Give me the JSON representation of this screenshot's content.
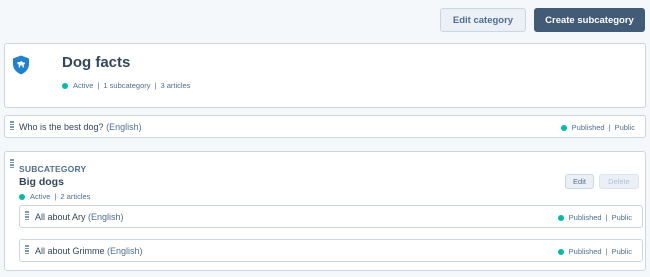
{
  "header": {
    "edit_category_label": "Edit category",
    "create_subcategory_label": "Create subcategory"
  },
  "category": {
    "icon": "dog-shield-icon",
    "title": "Dog facts",
    "status": "Active",
    "subcategory_count": "1 subcategory",
    "article_count": "3 articles",
    "separator": "|"
  },
  "articles": [
    {
      "title": "Who is the best dog?",
      "language": "(English)",
      "status": "Published",
      "visibility": "Public"
    }
  ],
  "subcategory": {
    "label": "SUBCATEGORY",
    "title": "Big dogs",
    "status": "Active",
    "article_count": "2 articles",
    "edit_label": "Edit",
    "delete_label": "Delete",
    "articles": [
      {
        "title": "All about Ary",
        "language": "(English)",
        "status": "Published",
        "visibility": "Public"
      },
      {
        "title": "All about Grimme",
        "language": "(English)",
        "status": "Published",
        "visibility": "Public"
      }
    ]
  },
  "colors": {
    "accent": "#0091ae",
    "status_green": "#00bda5",
    "primary_button": "#425b76",
    "icon_blue": "#1f82d1"
  }
}
